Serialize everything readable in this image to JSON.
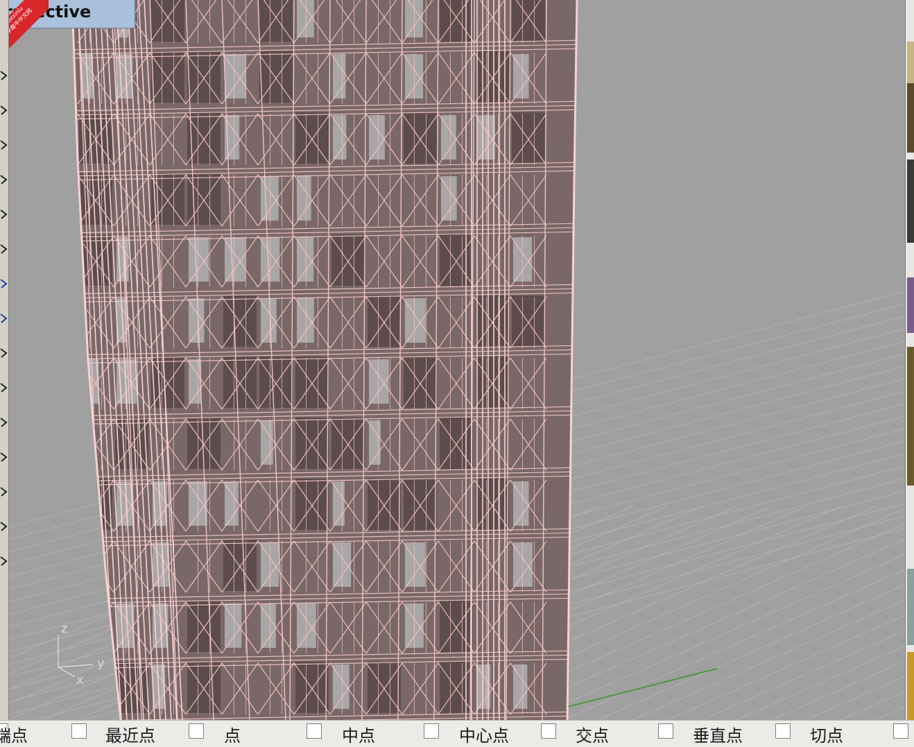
{
  "viewport": {
    "title": "Perspective",
    "axis_labels": {
      "z": "z",
      "y": "y",
      "x": "x"
    },
    "background_color": "#a0a0a0",
    "grid_color": "#b4b4b4",
    "wire_color": "#f4c8c8",
    "axis_green": "#4a9a3a"
  },
  "badge": {
    "text_line1": "xuexiniu",
    "text_line2": "学犀牛中文网"
  },
  "osnap": {
    "items": [
      {
        "label": "端点",
        "checked": false
      },
      {
        "label": "最近点",
        "checked": false
      },
      {
        "label": "点",
        "checked": false
      },
      {
        "label": "中点",
        "checked": false
      },
      {
        "label": "中心点",
        "checked": false
      },
      {
        "label": "交点",
        "checked": false
      },
      {
        "label": "垂直点",
        "checked": false
      },
      {
        "label": "切点",
        "checked": false
      }
    ]
  },
  "left_toolbar": {
    "icons": [
      "polyline-icon",
      "curve-icon",
      "rectangle-icon",
      "arc-icon",
      "circle-icon",
      "ellipse-icon",
      "sphere-icon",
      "surface-icon",
      "extrude-icon",
      "box-icon",
      "cylinder-icon",
      "boolean-icon",
      "dimension-icon",
      "transform-icon",
      "analyze-icon"
    ]
  }
}
